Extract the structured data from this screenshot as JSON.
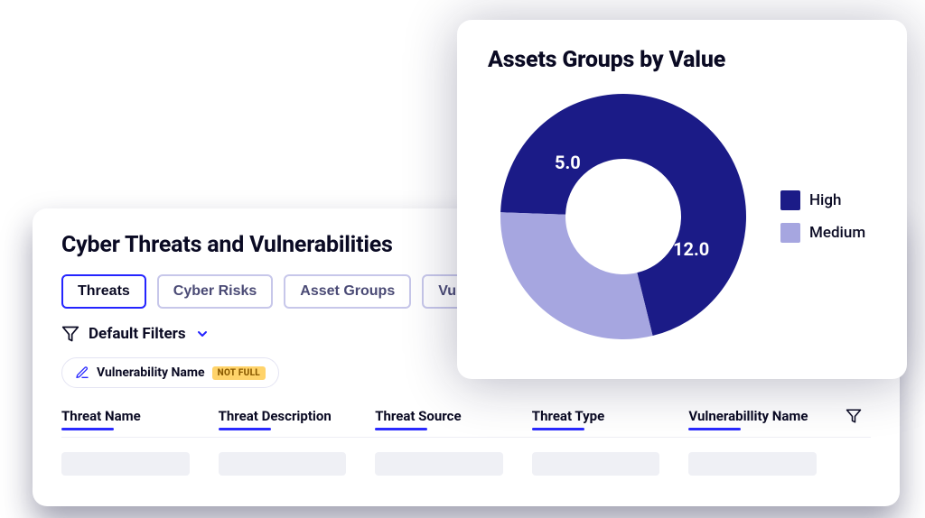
{
  "threats": {
    "title": "Cyber Threats and Vulnerabilities",
    "tabs": [
      {
        "label": "Threats",
        "active": true
      },
      {
        "label": "Cyber Risks",
        "active": false
      },
      {
        "label": "Asset Groups",
        "active": false
      },
      {
        "label": "Vulnerabilities",
        "active": false
      }
    ],
    "filters": {
      "label": "Default Filters",
      "chip_label": "Vulnerability Name",
      "chip_badge": "NOT FULL"
    },
    "columns": [
      "Threat Name",
      "Threat Description",
      "Threat Source",
      "Threat Type",
      "Vulnerabillity Name"
    ]
  },
  "chart_data": {
    "type": "pie",
    "title": "Assets Groups by Value",
    "series": [
      {
        "name": "High",
        "value": 12.0,
        "color": "#1b1b87"
      },
      {
        "name": "Medium",
        "value": 5.0,
        "color": "#a6a6e0"
      }
    ],
    "labels": {
      "high": "12.0",
      "medium": "5.0"
    },
    "legend": {
      "high": "High",
      "medium": "Medium"
    }
  }
}
